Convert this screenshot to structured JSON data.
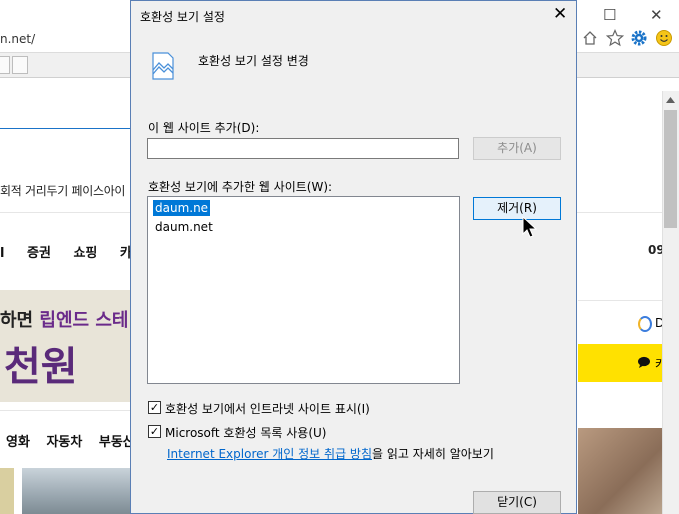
{
  "background": {
    "url_fragment": "n.net/",
    "nav_text": "회적 거리두기  페이스아이",
    "menu_items": [
      "증권",
      "쇼핑",
      "카카오"
    ],
    "menu_prefix": "l",
    "banner_line1_prefix": "하면 ",
    "banner_line1_highlight": "립엔드 스테",
    "banner_line2": "천원",
    "menu2_items": [
      "영화",
      "자동차",
      "부동산"
    ],
    "right_time": "09",
    "right_brand_letter": "D",
    "right_kakao_letter": "카",
    "window_controls": {
      "minimize": "—",
      "maximize": "☐",
      "close": "✕"
    }
  },
  "dialog": {
    "title": "호환성 보기 설정",
    "heading": "호환성 보기 설정 변경",
    "add_label": "이 웹 사이트 추가(D):",
    "add_input_value": "",
    "add_button": "추가(A)",
    "list_label": "호환성 보기에 추가한 웹 사이트(W):",
    "sites": [
      "daum.ne",
      "daum.net"
    ],
    "remove_button": "제거(R)",
    "checkbox1_label": "호환성 보기에서 인트라넷 사이트 표시(I)",
    "checkbox1_checked": true,
    "checkbox2_label": "Microsoft 호환성 목록 사용(U)",
    "checkbox2_checked": true,
    "link_text": "Internet Explorer 개인 정보 취급 방침",
    "link_suffix": "을 읽고 자세히 알아보기",
    "close_button": "닫기(C)",
    "close_icon": "✕",
    "check_mark": "✓"
  },
  "colors": {
    "selection": "#0078d7",
    "link": "#0066cc",
    "accent_purple": "#5a2a7a",
    "kakao_yellow": "#ffe100"
  }
}
